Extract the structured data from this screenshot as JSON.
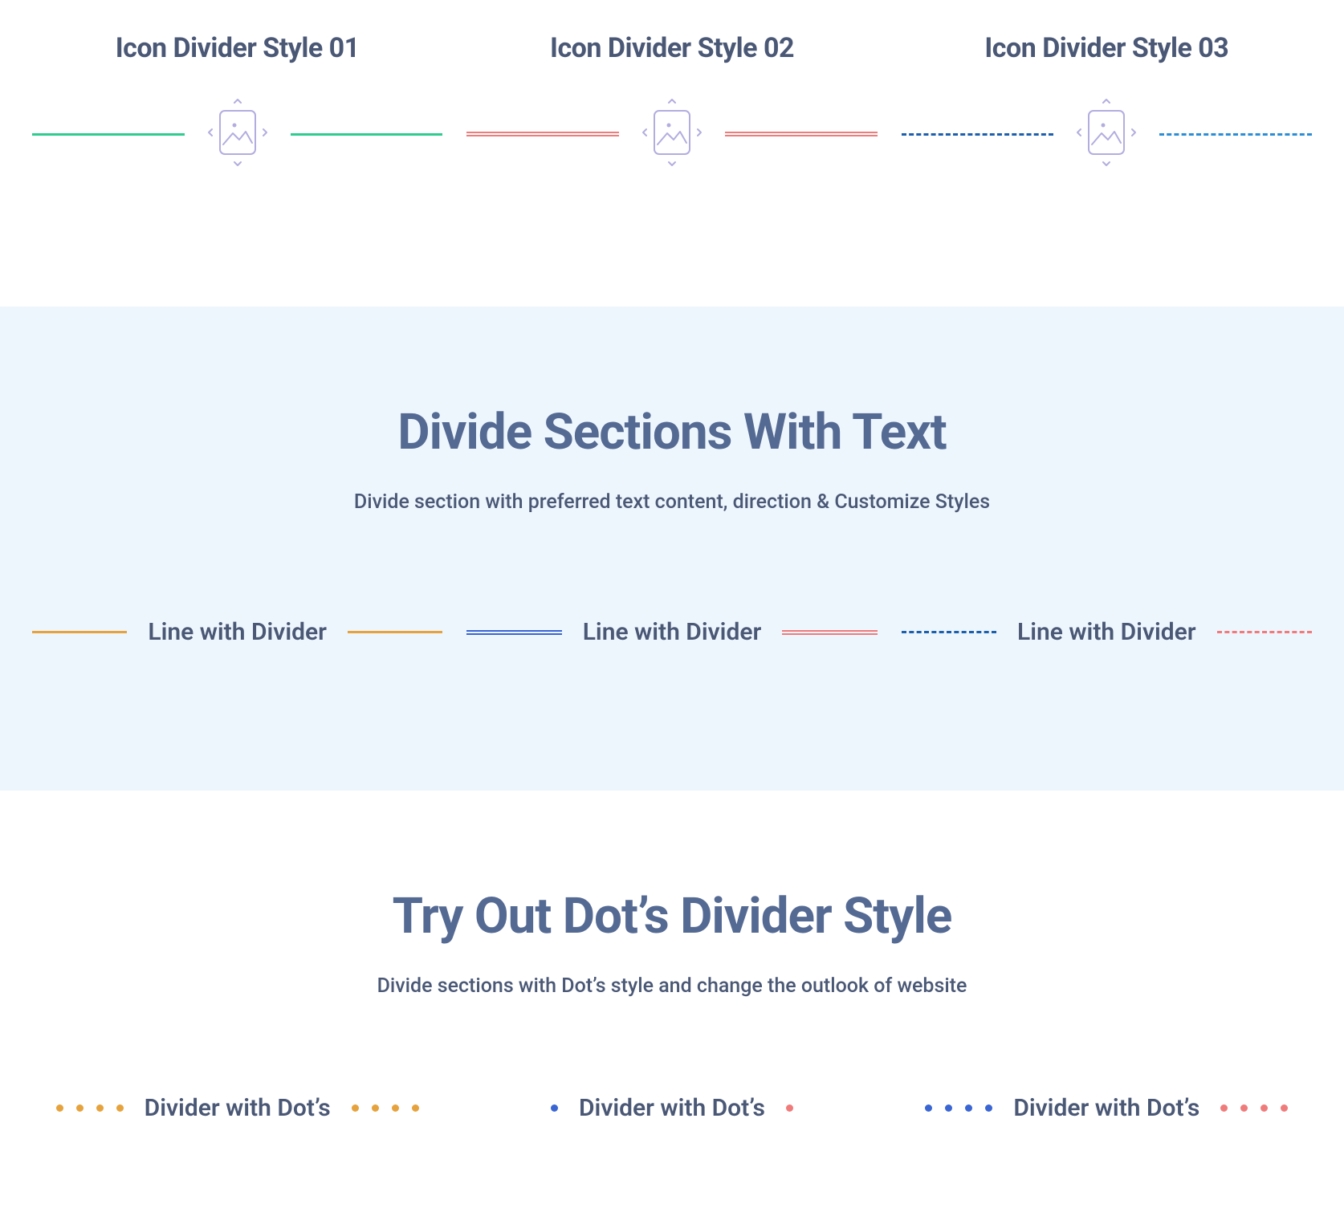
{
  "iconDividers": {
    "items": [
      {
        "title": "Icon Divider Style 01"
      },
      {
        "title": "Icon Divider Style 02"
      },
      {
        "title": "Icon Divider Style 03"
      }
    ]
  },
  "textSection": {
    "heading": "Divide Sections With Text",
    "subheading": "Divide section with preferred text content, direction & Customize Styles",
    "items": [
      {
        "label": "Line with Divider"
      },
      {
        "label": "Line with Divider"
      },
      {
        "label": "Line with Divider"
      }
    ]
  },
  "dotsSection": {
    "heading": "Try Out Dot’s Divider Style",
    "subheading": "Divide sections with Dot’s style and change the outlook of website",
    "items": [
      {
        "label": "Divider with Dot’s"
      },
      {
        "label": "Divider with Dot’s"
      },
      {
        "label": "Divider with Dot’s"
      }
    ]
  },
  "colors": {
    "accentGreen": "#2ecc8f",
    "accentRed": "#f07b7b",
    "accentNavy": "#1b5fad",
    "accentCyan": "#2a8dd6",
    "accentOrange": "#e6a23c",
    "accentBlue": "#3a66d4",
    "iconOutline": "#b2addf",
    "textPrimary": "#4a5876",
    "headingText": "#556a93",
    "panelBg": "#eef6fd"
  }
}
